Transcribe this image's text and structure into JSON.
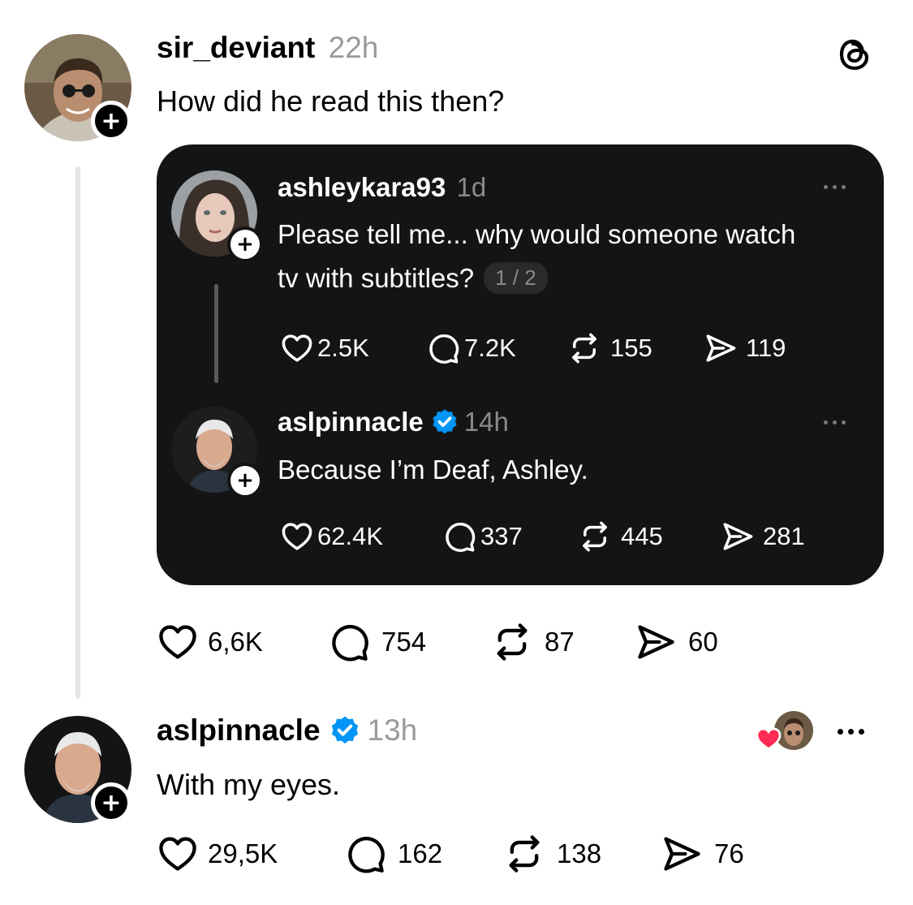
{
  "colors": {
    "verified": "#0095f6",
    "like_red": "#ff2d55",
    "card_bg": "#141414"
  },
  "post": {
    "username": "sir_deviant",
    "time": "22h",
    "text": "How did he read this then?",
    "actions": {
      "likes": "6,6K",
      "replies": "754",
      "reposts": "87",
      "shares": "60"
    }
  },
  "quote": {
    "post1": {
      "username": "ashleykara93",
      "time": "1d",
      "text_line1": "Please tell me... why would someone watch",
      "text_line2": "tv with subtitles?",
      "thread_badge": "1 / 2",
      "actions": {
        "likes": "2.5K",
        "replies": "7.2K",
        "reposts": "155",
        "shares": "119"
      }
    },
    "post2": {
      "username": "aslpinnacle",
      "time": "14h",
      "text": "Because I’m Deaf, Ashley.",
      "actions": {
        "likes": "62.4K",
        "replies": "337",
        "reposts": "445",
        "shares": "281"
      }
    }
  },
  "reply": {
    "username": "aslpinnacle",
    "time": "13h",
    "text": "With my eyes.",
    "actions": {
      "likes": "29,5K",
      "replies": "162",
      "reposts": "138",
      "shares": "76"
    }
  },
  "icons": [
    "threads-logo-icon",
    "plus-icon",
    "heart-icon",
    "comment-icon",
    "repost-icon",
    "share-icon",
    "verified-icon",
    "more-icon"
  ]
}
